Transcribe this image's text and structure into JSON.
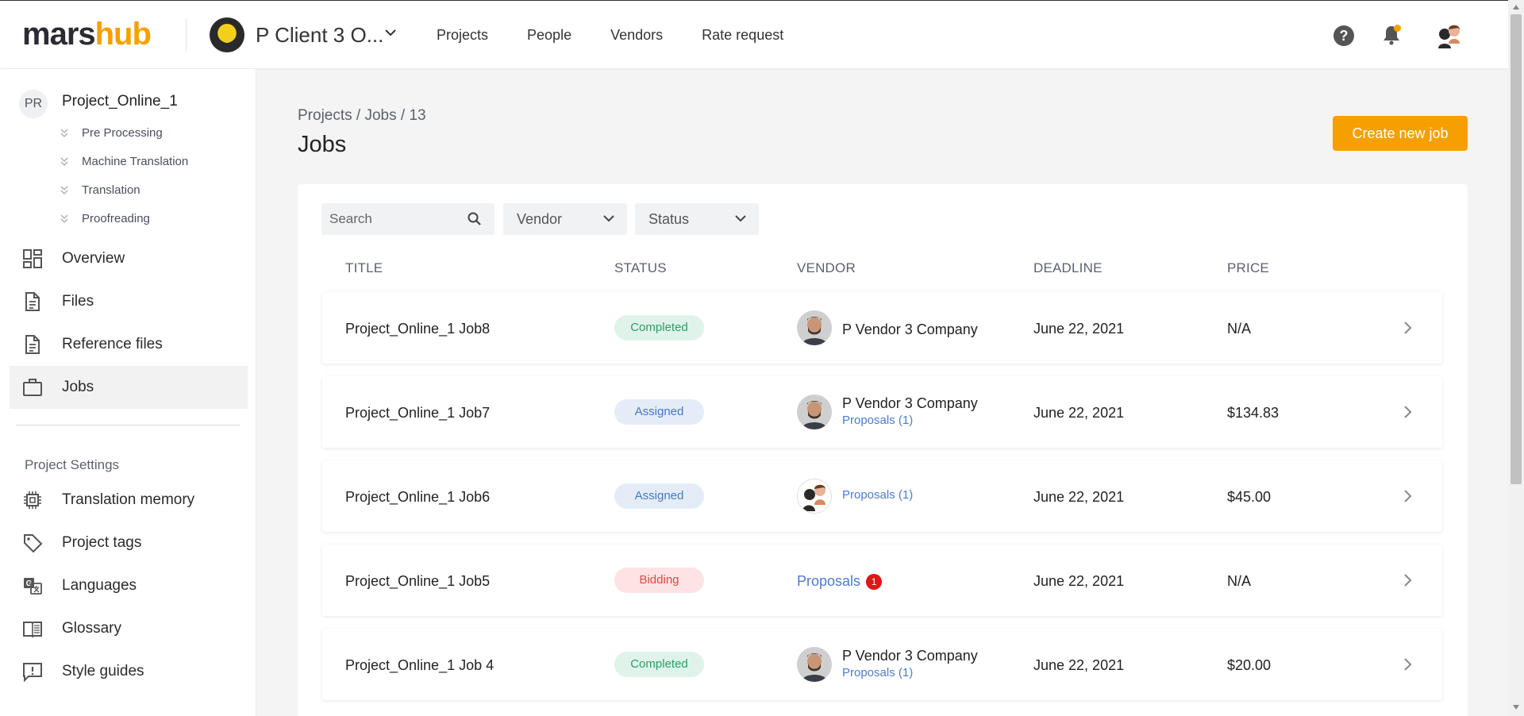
{
  "header": {
    "logo_part1": "mars",
    "logo_part2": "hub",
    "client_name": "P Client 3 O...",
    "nav": [
      "Projects",
      "People",
      "Vendors",
      "Rate request"
    ],
    "accent_color": "#f6a000"
  },
  "sidebar": {
    "project_badge": "PR",
    "project_name": "Project_Online_1",
    "subitems": [
      "Pre Processing",
      "Machine Translation",
      "Translation",
      "Proofreading"
    ],
    "nav": [
      {
        "label": "Overview",
        "icon": "dashboard-icon"
      },
      {
        "label": "Files",
        "icon": "file-icon"
      },
      {
        "label": "Reference files",
        "icon": "reference-file-icon"
      },
      {
        "label": "Jobs",
        "icon": "briefcase-icon",
        "active": true
      }
    ],
    "settings_label": "Project Settings",
    "settings": [
      {
        "label": "Translation memory",
        "icon": "chip-icon"
      },
      {
        "label": "Project tags",
        "icon": "tag-icon"
      },
      {
        "label": "Languages",
        "icon": "translate-icon"
      },
      {
        "label": "Glossary",
        "icon": "book-icon"
      },
      {
        "label": "Style guides",
        "icon": "comment-alert-icon"
      }
    ]
  },
  "main": {
    "breadcrumb": "Projects / Jobs / 13",
    "title": "Jobs",
    "create_button": "Create new job",
    "search_placeholder": "Search",
    "vendor_filter": "Vendor",
    "status_filter": "Status",
    "columns": {
      "title": "TITLE",
      "status": "STATUS",
      "vendor": "VENDOR",
      "deadline": "DEADLINE",
      "price": "PRICE"
    },
    "rows": [
      {
        "title": "Project_Online_1 Job8",
        "status": "Completed",
        "vendor": "P Vendor 3 Company",
        "proposals": "",
        "deadline": "June 22, 2021",
        "price": "N/A"
      },
      {
        "title": "Project_Online_1 Job7",
        "status": "Assigned",
        "vendor": "P Vendor 3 Company",
        "proposals": "Proposals (1)",
        "deadline": "June 22, 2021",
        "price": "$134.83"
      },
      {
        "title": "Project_Online_1 Job6",
        "status": "Assigned",
        "vendor": "",
        "proposals": "Proposals (1)",
        "deadline": "June 22, 2021",
        "price": "$45.00"
      },
      {
        "title": "Project_Online_1 Job5",
        "status": "Bidding",
        "vendor": "",
        "proposals": "Proposals",
        "proposal_count": "1",
        "deadline": "June 22, 2021",
        "price": "N/A"
      },
      {
        "title": "Project_Online_1 Job 4",
        "status": "Completed",
        "vendor": "P Vendor 3 Company",
        "proposals": "Proposals (1)",
        "deadline": "June 22, 2021",
        "price": "$20.00"
      }
    ]
  }
}
